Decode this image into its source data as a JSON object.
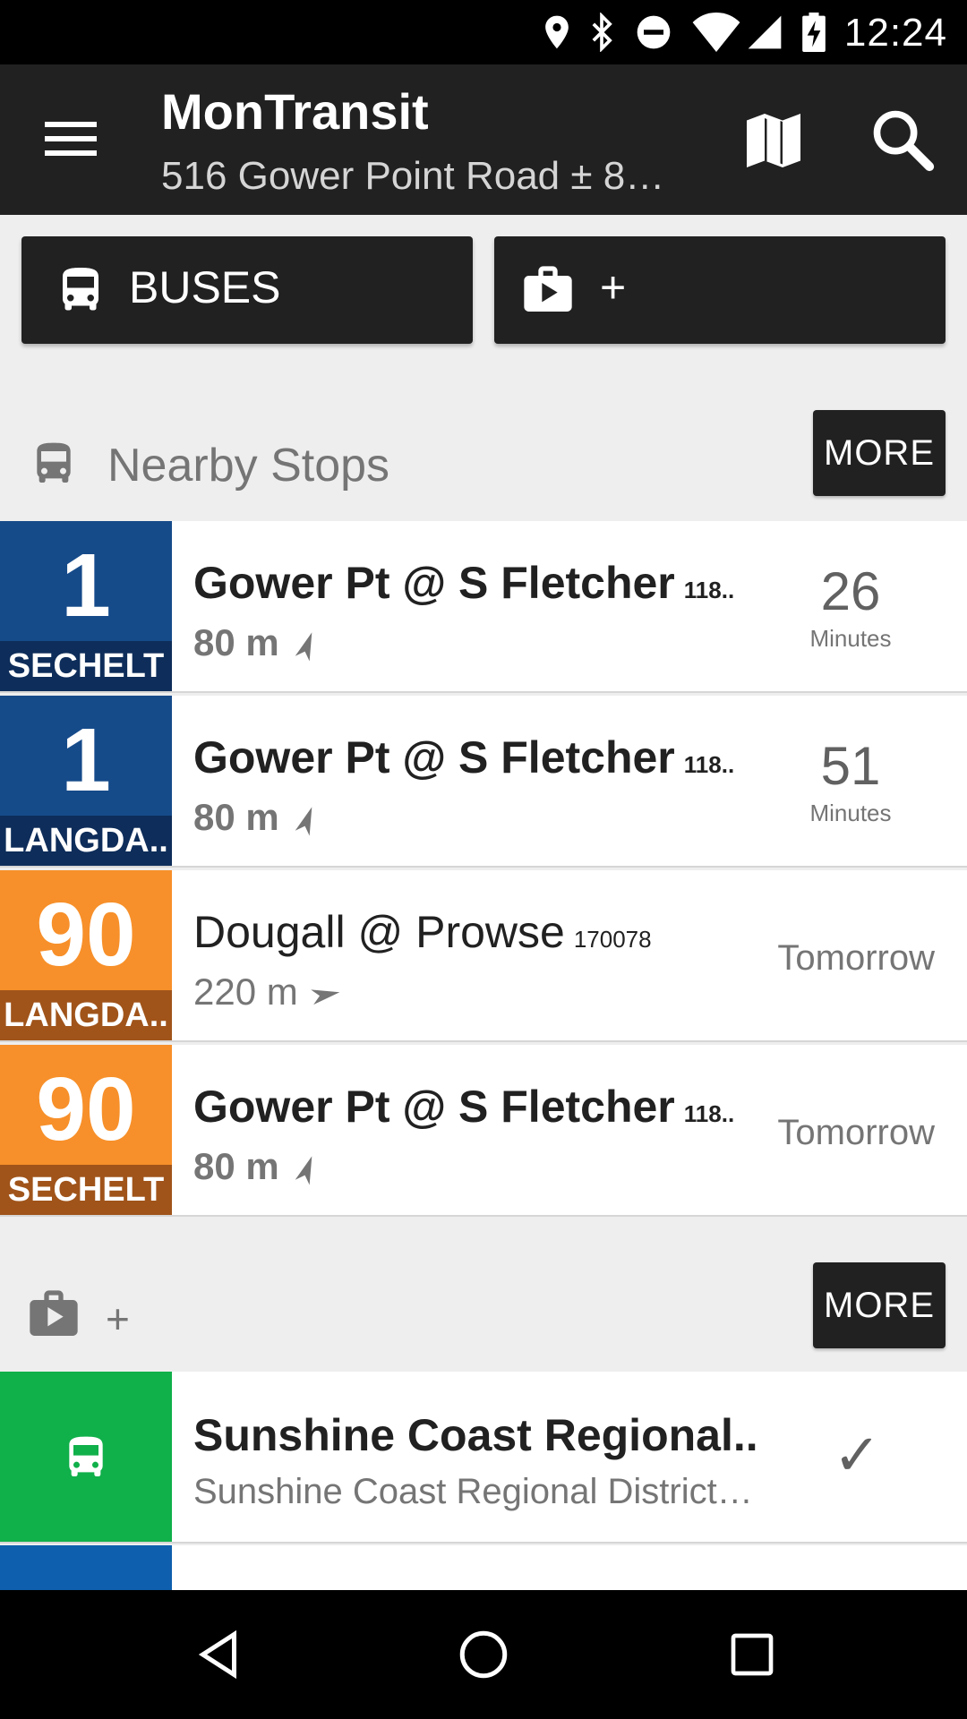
{
  "status_bar": {
    "time": "12:24",
    "icons": [
      "location-icon",
      "bluetooth-icon",
      "do-not-disturb-icon",
      "wifi-icon",
      "cell-signal-icon",
      "battery-charging-icon"
    ]
  },
  "app_bar": {
    "title": "MonTransit",
    "subtitle": "516 Gower Point Road ± 8…"
  },
  "top_buttons": [
    {
      "label": "BUSES",
      "icon": "bus-icon"
    },
    {
      "label": "+",
      "icon": "play-store-icon"
    }
  ],
  "nearby": {
    "title": "Nearby Stops",
    "more_label": "MORE",
    "stops": [
      {
        "route": "1",
        "direction": "SECHELT",
        "color": "#164b8a",
        "dir_color": "#0e2d5a",
        "name": "Gower Pt @ S Fletcher",
        "code": "118..",
        "distance": "80 m",
        "time_value": "26",
        "time_unit": "Minutes"
      },
      {
        "route": "1",
        "direction": "LANGDA..",
        "color": "#164b8a",
        "dir_color": "#0e2d5a",
        "name": "Gower Pt @ S Fletcher",
        "code": "118..",
        "distance": "80 m",
        "time_value": "51",
        "time_unit": "Minutes"
      },
      {
        "route": "90",
        "direction": "LANGDA..",
        "color": "#f7902a",
        "dir_color": "#a0541a",
        "name": "Dougall @ Prowse",
        "code": "170078",
        "distance": "220 m",
        "time_text": "Tomorrow"
      },
      {
        "route": "90",
        "direction": "SECHELT",
        "color": "#f7902a",
        "dir_color": "#a0541a",
        "name": "Gower Pt @ S Fletcher",
        "code": "118..",
        "distance": "80 m",
        "time_text": "Tomorrow"
      }
    ]
  },
  "store_section": {
    "title": "+",
    "more_label": "MORE",
    "items": [
      {
        "name": "Sunshine Coast Regional..",
        "desc": "Sunshine Coast Regional District…",
        "color": "#10b04a",
        "status": "✓"
      }
    ],
    "partial_color": "#0e5fad"
  },
  "colors": {
    "dark": "#212121",
    "background": "#eeeeee"
  }
}
